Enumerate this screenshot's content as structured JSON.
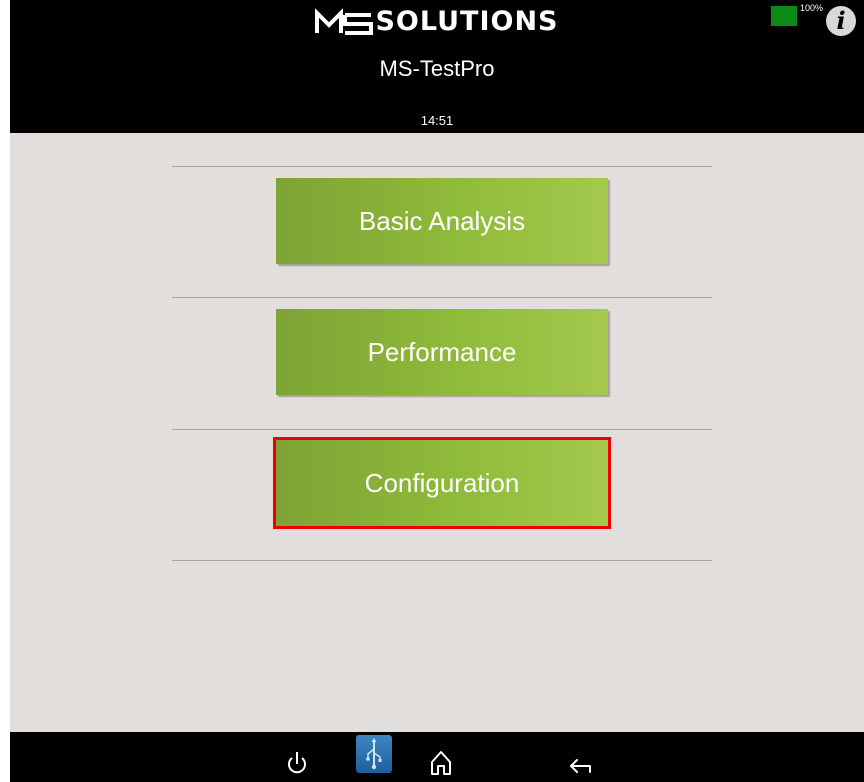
{
  "header": {
    "logo_text": "SOLUTIONS",
    "app_title": "MS-TestPro",
    "time": "14:51",
    "battery_level": "100%",
    "battery_color": "#0c8a18",
    "info_icon": "info-icon"
  },
  "menu": {
    "items": [
      {
        "label": "Basic Analysis"
      },
      {
        "label": "Performance"
      },
      {
        "label": "Configuration"
      }
    ],
    "highlight_color": "#ee0000",
    "button_color": "#8fbb3a"
  },
  "footer": {
    "icons": [
      "power-icon",
      "usb-icon",
      "home-icon",
      "back-icon"
    ]
  }
}
